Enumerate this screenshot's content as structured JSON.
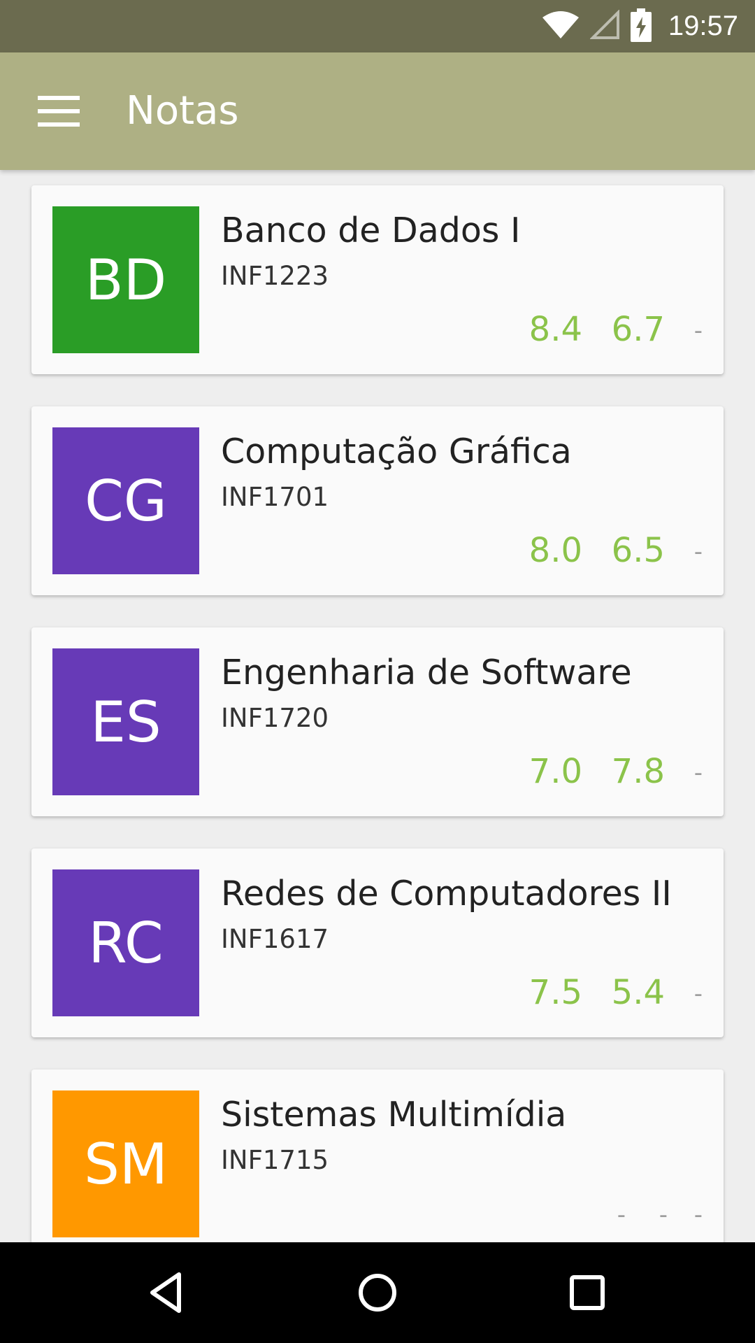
{
  "status_bar": {
    "time": "19:57",
    "icons": [
      "wifi-icon",
      "cell-signal-icon",
      "battery-charging-icon"
    ]
  },
  "app_bar": {
    "title": "Notas",
    "menu_icon": "hamburger-menu-icon"
  },
  "courses": [
    {
      "initials": "BD",
      "name": "Banco de Dados I",
      "code": "INF1223",
      "color": "#2a9d26",
      "grades": [
        "8.4",
        "6.7",
        "-"
      ]
    },
    {
      "initials": "CG",
      "name": "Computação Gráfica",
      "code": "INF1701",
      "color": "#673ab7",
      "grades": [
        "8.0",
        "6.5",
        "-"
      ]
    },
    {
      "initials": "ES",
      "name": "Engenharia de Software",
      "code": "INF1720",
      "color": "#673ab7",
      "grades": [
        "7.0",
        "7.8",
        "-"
      ]
    },
    {
      "initials": "RC",
      "name": "Redes de Computadores II",
      "code": "INF1617",
      "color": "#673ab7",
      "grades": [
        "7.5",
        "5.4",
        "-"
      ]
    },
    {
      "initials": "SM",
      "name": "Sistemas Multimídia",
      "code": "INF1715",
      "color": "#ff9800",
      "grades": [
        "-",
        "-",
        "-"
      ]
    }
  ],
  "nav_bar": {
    "icons": [
      "back-icon",
      "home-icon",
      "recents-icon"
    ]
  },
  "colors": {
    "status_bar": "#6b6b4f",
    "app_bar": "#aeb084",
    "grade_green": "#8bc34a",
    "grade_empty": "#9e9e9e"
  }
}
